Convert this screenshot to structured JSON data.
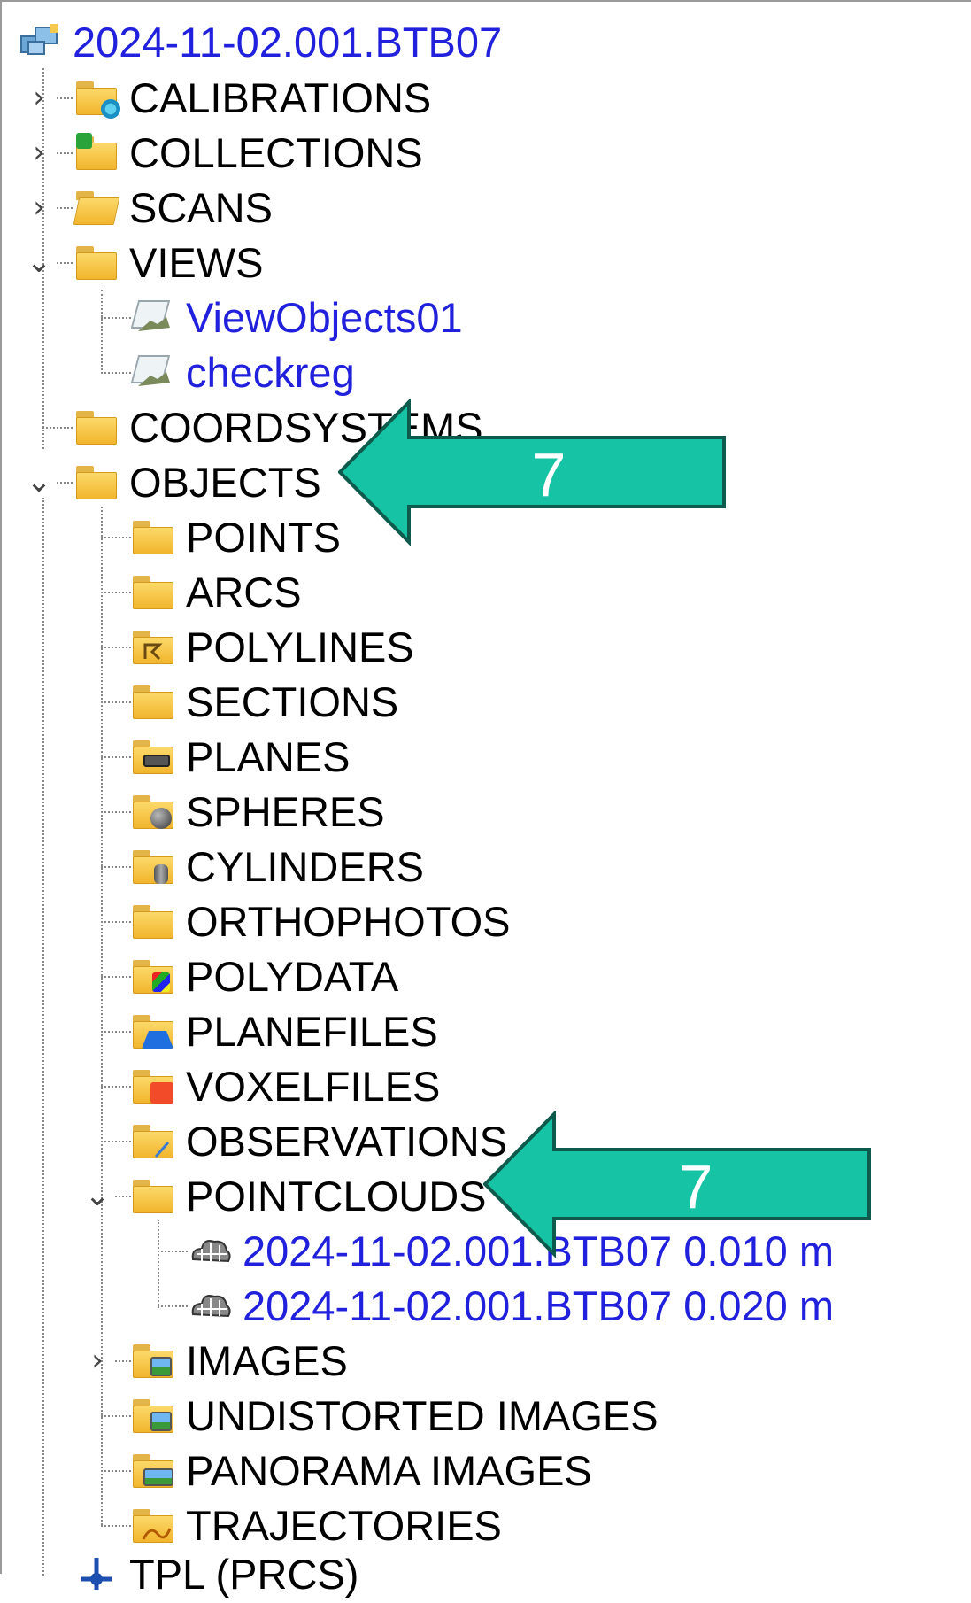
{
  "tree": {
    "root": {
      "label": "2024-11-02.001.BTB07",
      "icon": "project-icon"
    },
    "items": [
      {
        "label": "CALIBRATIONS",
        "icon": "calibrations-folder-icon",
        "expander": "collapsed"
      },
      {
        "label": "COLLECTIONS",
        "icon": "collections-folder-icon",
        "expander": "collapsed"
      },
      {
        "label": "SCANS",
        "icon": "scans-folder-icon",
        "expander": "collapsed"
      },
      {
        "label": "VIEWS",
        "icon": "folder-icon",
        "expander": "expanded"
      },
      {
        "label": "ViewObjects01",
        "icon": "view-icon"
      },
      {
        "label": "checkreg",
        "icon": "view-icon"
      },
      {
        "label": "COORDSYSTEMS",
        "icon": "folder-icon"
      },
      {
        "label": "OBJECTS",
        "icon": "folder-icon",
        "expander": "expanded"
      },
      {
        "label": "POINTS",
        "icon": "folder-icon"
      },
      {
        "label": "ARCS",
        "icon": "folder-icon"
      },
      {
        "label": "POLYLINES",
        "icon": "polylines-folder-icon"
      },
      {
        "label": "SECTIONS",
        "icon": "folder-icon"
      },
      {
        "label": "PLANES",
        "icon": "planes-folder-icon"
      },
      {
        "label": "SPHERES",
        "icon": "spheres-folder-icon"
      },
      {
        "label": "CYLINDERS",
        "icon": "cylinders-folder-icon"
      },
      {
        "label": "ORTHOPHOTOS",
        "icon": "folder-icon"
      },
      {
        "label": "POLYDATA",
        "icon": "polydata-folder-icon"
      },
      {
        "label": "PLANEFILES",
        "icon": "planefiles-folder-icon"
      },
      {
        "label": "VOXELFILES",
        "icon": "voxelfiles-folder-icon"
      },
      {
        "label": "OBSERVATIONS",
        "icon": "observations-folder-icon"
      },
      {
        "label": "POINTCLOUDS",
        "icon": "folder-icon",
        "expander": "expanded"
      },
      {
        "label": "2024-11-02.001.BTB07 0.010 m",
        "icon": "pointcloud-icon"
      },
      {
        "label": "2024-11-02.001.BTB07 0.020 m",
        "icon": "pointcloud-icon"
      },
      {
        "label": "IMAGES",
        "icon": "images-folder-icon",
        "expander": "collapsed"
      },
      {
        "label": "UNDISTORTED IMAGES",
        "icon": "images-folder-icon"
      },
      {
        "label": "PANORAMA IMAGES",
        "icon": "panorama-folder-icon"
      },
      {
        "label": "TRAJECTORIES",
        "icon": "trajectories-folder-icon"
      },
      {
        "label": "TPL (PRCS)",
        "icon": "coordsys-icon"
      }
    ]
  },
  "annotations": [
    {
      "number": "7",
      "color": "#17c3a5",
      "target": "OBJECTS"
    },
    {
      "number": "7",
      "color": "#17c3a5",
      "target": "POINTCLOUDS"
    }
  ],
  "colors": {
    "link_blue": "#2020dd",
    "folder_yellow": "#f7c744",
    "annotation_teal": "#17c3a5"
  }
}
